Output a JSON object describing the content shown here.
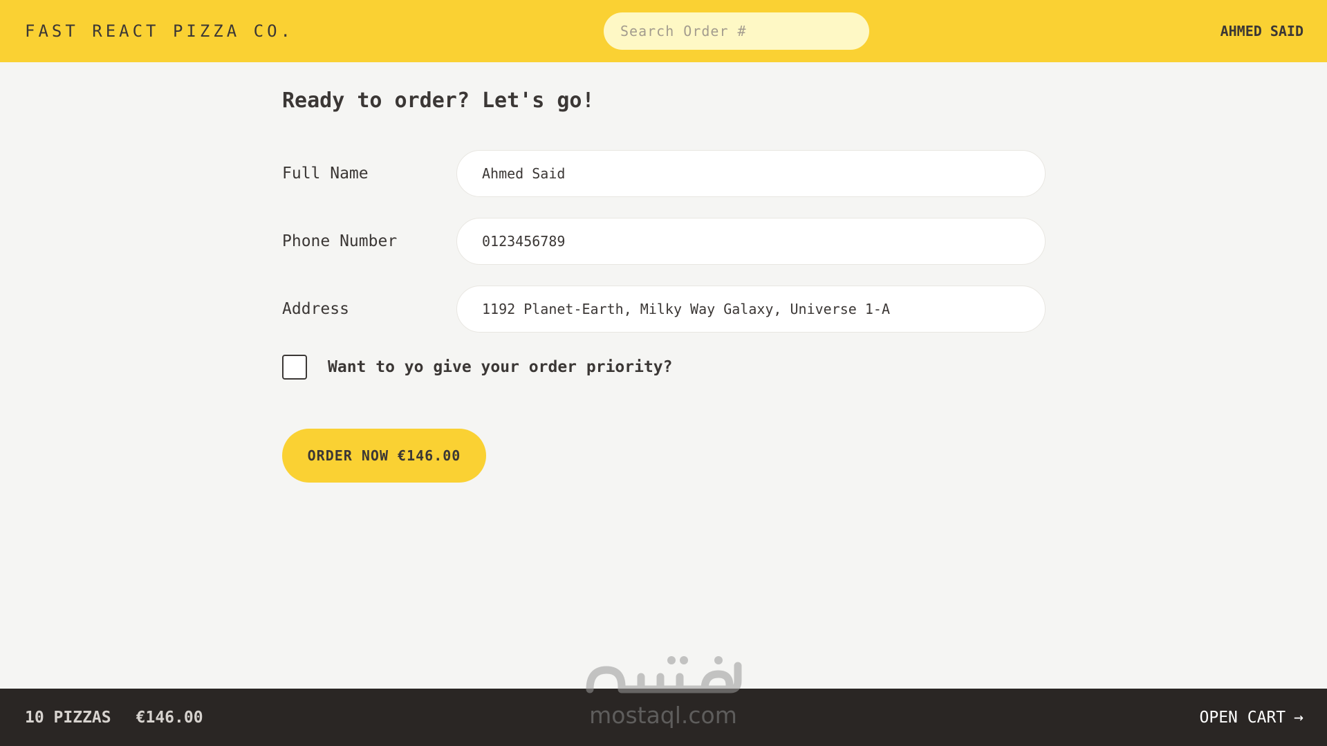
{
  "header": {
    "logo": "FAST REACT PIZZA CO.",
    "search_placeholder": "Search Order #",
    "user_name": "AHMED SAID"
  },
  "form": {
    "title": "Ready to order? Let's go!",
    "fields": [
      {
        "label": "Full Name",
        "value": "Ahmed Said"
      },
      {
        "label": "Phone Number",
        "value": "0123456789"
      },
      {
        "label": "Address",
        "value": "1192 Planet-Earth, Milky Way Galaxy, Universe 1-A"
      }
    ],
    "priority_label": "Want to yo give your order priority?",
    "priority_checked": false,
    "order_button": "ORDER NOW €146.00"
  },
  "footer": {
    "pizza_count": "10 PIZZAS",
    "total": "€146.00",
    "open_cart": "OPEN CART",
    "open_cart_arrow": "→"
  },
  "watermark": {
    "text": "mostaql.com",
    "logo_text": "مستقل"
  },
  "colors": {
    "accent": "#fad133",
    "search_bg": "#fef8c5",
    "page_bg": "#f5f5f3",
    "footer_bg": "#2a2624",
    "text": "#3b3735"
  }
}
